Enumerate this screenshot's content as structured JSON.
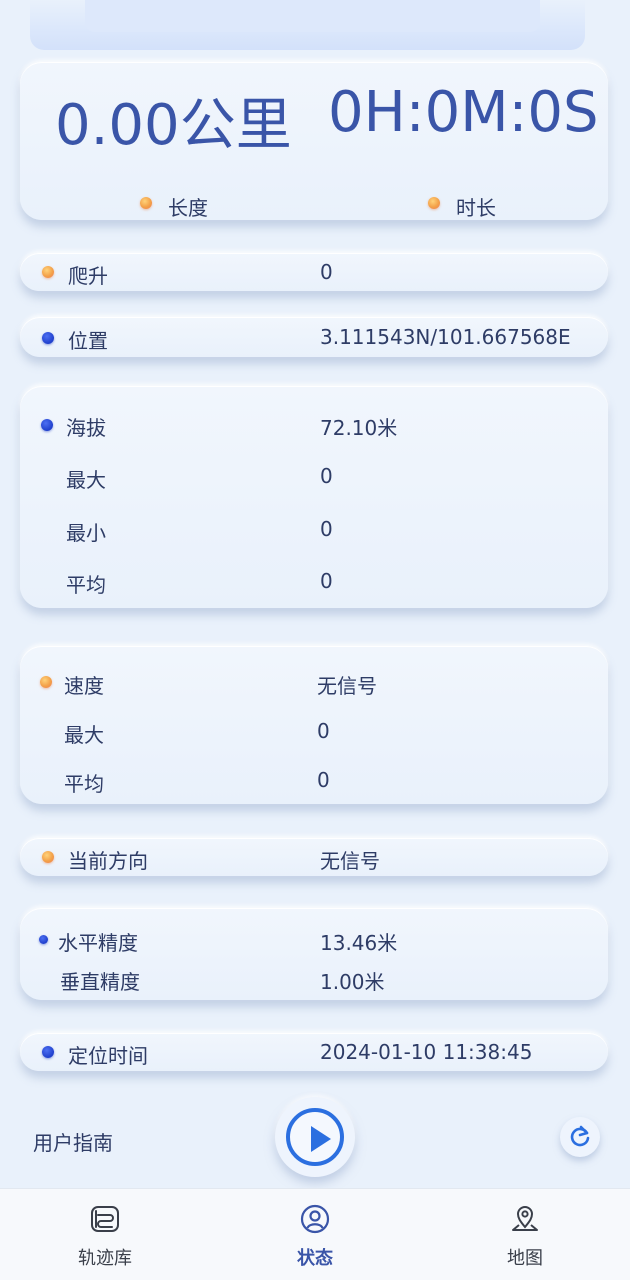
{
  "summary": {
    "distance": "0.00公里",
    "duration": "0H:0M:0S",
    "distance_label": "长度",
    "duration_label": "时长"
  },
  "climb": {
    "label": "爬升",
    "value": "0"
  },
  "position": {
    "label": "位置",
    "value": "3.111543N/101.667568E"
  },
  "altitude": {
    "label": "海拔",
    "value": "72.10米",
    "max_label": "最大",
    "max_value": "0",
    "min_label": "最小",
    "min_value": "0",
    "avg_label": "平均",
    "avg_value": "0"
  },
  "speed": {
    "label": "速度",
    "value": "无信号",
    "max_label": "最大",
    "max_value": "0",
    "avg_label": "平均",
    "avg_value": "0"
  },
  "heading": {
    "label": "当前方向",
    "value": "无信号"
  },
  "accuracy": {
    "h_label": "水平精度",
    "h_value": "13.46米",
    "v_label": "垂直精度",
    "v_value": "1.00米"
  },
  "fix_time": {
    "label": "定位时间",
    "value": "2024-01-10 11:38:45"
  },
  "controls": {
    "guide_label": "用户指南"
  },
  "tabs": {
    "library": "轨迹库",
    "status": "状态",
    "map": "地图"
  },
  "colors": {
    "accent": "#3a55a8",
    "play": "#2b6fe0",
    "dot_orange": "#f3a149",
    "dot_blue": "#1f3fcc"
  }
}
